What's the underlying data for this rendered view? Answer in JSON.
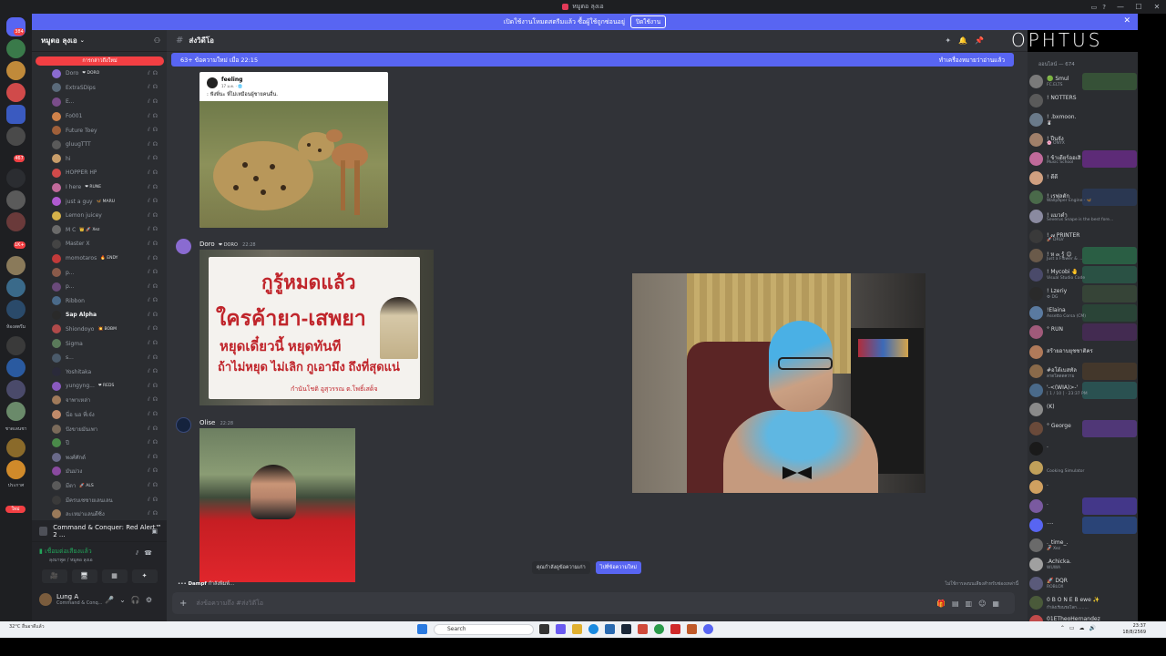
{
  "window": {
    "title": "หมูตอ ลุงเอ",
    "controls": [
      "—",
      "☐",
      "✕"
    ]
  },
  "banner": {
    "text": "เปิดใช้งานโหมดสตรีมแล้ว ซื้อผู้ใช้ถูกซ่อนอยู่",
    "button": "ปิดใช้งาน",
    "close": "✕"
  },
  "rail": {
    "badges": [
      "384",
      "467",
      "1K+"
    ],
    "labels": [
      "ห้องสตรีม",
      "ชาดเลนชา",
      "ประกาศ",
      "ใหม่"
    ]
  },
  "server": {
    "name": "หมูตอ ลุงเอ",
    "chevron": "⌄",
    "new_pill": "การกล่าวถึงใหม่"
  },
  "members_voice": [
    {
      "name": "Doro",
      "tag": "❤ DORO",
      "bold": false,
      "color": "#8a6bd1"
    },
    {
      "name": "ExtraSDips",
      "tag": "",
      "bold": false,
      "color": "#5a6a7a"
    },
    {
      "name": "E...",
      "tag": "",
      "bold": false,
      "color": "#7a4d8a"
    },
    {
      "name": "Fo001",
      "tag": "",
      "bold": false,
      "color": "#d0824a"
    },
    {
      "name": "Future Toey",
      "tag": "",
      "bold": false,
      "color": "#a0603a"
    },
    {
      "name": "gluugTTT",
      "tag": "",
      "bold": false,
      "color": "#5a5a5a"
    },
    {
      "name": "hi",
      "tag": "",
      "bold": false,
      "color": "#c89d6a"
    },
    {
      "name": "HOPPER HP",
      "tag": "",
      "bold": false,
      "color": "#d04a4a"
    },
    {
      "name": "I here",
      "tag": "❤ RUNE",
      "bold": false,
      "color": "#c06a9a"
    },
    {
      "name": "just a guy",
      "tag": "🦋 MARU",
      "bold": false,
      "color": "#b05ad0"
    },
    {
      "name": "Lemon juicey",
      "tag": "",
      "bold": false,
      "color": "#d6b24a"
    },
    {
      "name": "M C",
      "tag": "👑 🚀 Xez",
      "bold": false,
      "color": "#6a6a6a"
    },
    {
      "name": "Master X",
      "tag": "",
      "bold": false,
      "color": "#444"
    },
    {
      "name": "momotaros",
      "tag": "🔥 ENDY",
      "bold": false,
      "color": "#c23a3a"
    },
    {
      "name": "p...",
      "tag": "",
      "bold": false,
      "color": "#8a5a4a"
    },
    {
      "name": "p...",
      "tag": "",
      "bold": false,
      "color": "#6a4a7a"
    },
    {
      "name": "Ribbon",
      "tag": "",
      "bold": false,
      "color": "#4a6a8a"
    },
    {
      "name": "Sap Alpha",
      "tag": "",
      "bold": true,
      "color": "#2a2a2a"
    },
    {
      "name": "Shiondoyo",
      "tag": "💥 BOBM",
      "bold": false,
      "color": "#b04a4a"
    },
    {
      "name": "Sigma",
      "tag": "",
      "bold": false,
      "color": "#5a7a5a"
    },
    {
      "name": "s...",
      "tag": "",
      "bold": false,
      "color": "#4a5a6a"
    },
    {
      "name": "Yoshitaka",
      "tag": "",
      "bold": false,
      "color": "#2a2a3a"
    },
    {
      "name": "yungyng...",
      "tag": "❤ REDS",
      "bold": false,
      "color": "#8a5ac0"
    },
    {
      "name": "จาพาเหล่า",
      "tag": "",
      "bold": false,
      "color": "#a07a5a"
    },
    {
      "name": "นี่อ นอ ที่เจ๋ง",
      "tag": "",
      "bold": false,
      "color": "#c08a6a"
    },
    {
      "name": "ปังขายมันเพา",
      "tag": "",
      "bold": false,
      "color": "#7a6a5a"
    },
    {
      "name": "ปี",
      "tag": "",
      "bold": false,
      "color": "#4a8a4a"
    },
    {
      "name": "พงศ์ศักด์",
      "tag": "",
      "bold": false,
      "color": "#6a6a8a"
    },
    {
      "name": "มันม่วง",
      "tag": "",
      "bold": false,
      "color": "#8a4aa0"
    },
    {
      "name": "มีตา",
      "tag": "🚀 ALS",
      "bold": false,
      "color": "#5a5a5a"
    },
    {
      "name": "มีครบเซซายเลนเลน",
      "tag": "",
      "bold": false,
      "color": "#3a3a3a"
    },
    {
      "name": "ละเหม่าแลนดีซิ่ง",
      "tag": "",
      "bold": false,
      "color": "#9a7a5a"
    }
  ],
  "voice": {
    "activity": "Command & Conquer: Red Alert™ 2 ...",
    "connected": "เชื่อมต่อเสียงแล้ว",
    "channel": "ลุงมาพูด / หมูตอ ลุงเอ",
    "buttons": [
      "🎥",
      "🖥",
      "▦",
      "✦"
    ]
  },
  "user": {
    "name": "Lung A",
    "status": "Command & Conq..."
  },
  "channel": {
    "name": "ส่งวิดีโอ",
    "hash": "#"
  },
  "new_messages": {
    "left": "63+ ข้อความใหม่ เมื่อ 22:15",
    "right": "ทำเครื่องหมายว่าอ่านแล้ว"
  },
  "messages": [
    {
      "author": "Doro",
      "role": "DORO",
      "time": "22:28"
    },
    {
      "author": "Olise",
      "role": "",
      "time": "22:28"
    }
  ],
  "embed": {
    "page": "feeling",
    "sub": "17 ม.ค. · 🌐",
    "caption": ": ฟังพี่นะ พี่ไม่เหมือนผู้ชายคนอื่น."
  },
  "sign": {
    "line1": "กูรู้หมดแล้ว",
    "line2": "ใครค้ายา-เสพยา",
    "line3": "หยุดเดี๋ยวนี้ หยุดทันที",
    "line4": "ถ้าไม่หยุด ไม่เลิก กูเอามึง ถึงที่สุดแน่",
    "line5": "กำนันโชติ อูสุวรรณ ต.โพธิ์เสด็จ"
  },
  "typing": {
    "who": "Dampf",
    "text": "กำลังพิมพ์..."
  },
  "slow_mode": "ไม่ใช้การลงบนเสียงสำหรับช่องเหล่านี้",
  "new_controls": {
    "jump_old": "คุณกำลังดูข้อความเก่า",
    "jump_new": "ไปที่ข้อความใหม่"
  },
  "composer": {
    "placeholder": "ส่งข้อความถึง #ส่งวิดีโอ"
  },
  "brand_overlay": "OPHTUS",
  "member_list": {
    "group_header": "ออนไลน์ — 674",
    "items": [
      {
        "name": "🟢 Smul",
        "sub": "FC.ELTS",
        "color": "#7a7a7a",
        "bg": "#3a5a3a"
      },
      {
        "name": "! NOTTERS",
        "sub": "",
        "color": "#5a5a5a",
        "bg": ""
      },
      {
        "name": "! .bxmoon.",
        "sub": "🐰",
        "color": "#6a7a8a",
        "bg": ""
      },
      {
        "name": "! ปีนจัง",
        "sub": "🌸 ONYX",
        "color": "#a0806a",
        "bg": ""
      },
      {
        "name": "! ข้าเดียร์ออเสิ",
        "sub": "Music School",
        "color": "#c06a9a",
        "bg": "#6a2a8a"
      },
      {
        "name": "! ดีดี",
        "sub": "",
        "color": "#d0a080",
        "bg": ""
      },
      {
        "name": "! เรฟุลตัก",
        "sub": "Wallpaper Engine · 🦋",
        "color": "#4a6a4a",
        "bg": "#2a3a5a"
      },
      {
        "name": "! แมวดำ",
        "sub": "Severus Snape is the best fore...",
        "color": "#8a8aa0",
        "bg": ""
      },
      {
        "name": "! ๗ PRINTER",
        "sub": "🚀 DRLV",
        "color": "#3a3a3a",
        "bg": ""
      },
      {
        "name": "! ห ๓ รู้ 😊",
        "sub": "Just a Flower & ...",
        "color": "#6a5a4a",
        "bg": "#2a6a4a"
      },
      {
        "name": "! Mycobi 🤚",
        "sub": "Visual Studio Code",
        "color": "#4a4a6a",
        "bg": "#2a5a4a"
      },
      {
        "name": "! Lzeriy",
        "sub": "⚙ DG",
        "color": "#2a2a2a",
        "bg": "#3a4a3a"
      },
      {
        "name": "!Elaina",
        "sub": "Assetto Corsa (CM)",
        "color": "#5a7aa0",
        "bg": "#2a4a3a"
      },
      {
        "name": "° RUN",
        "sub": "",
        "color": "#a05a7a",
        "bg": "#4a2a5a"
      },
      {
        "name": "สร้ายอาบยุชชาติคร",
        "sub": "",
        "color": "#b07a5a",
        "bg": ""
      },
      {
        "name": "#อโด้เบสทัล",
        "sub": "ลาดโดดดความ",
        "color": "#8a6a4a",
        "bg": "#4a3a2a"
      },
      {
        "name": "'-<(WIA)>-'",
        "sub": "[ 1 / 10 ] · 23:37 PM",
        "color": "#4a6a8a",
        "bg": "#2a5a5a"
      },
      {
        "name": "(K)",
        "sub": "",
        "color": "#8a8a8a",
        "bg": ""
      },
      {
        "name": "° George",
        "sub": "",
        "color": "#6a4a3a",
        "bg": "#5a3a8a"
      },
      {
        "name": ".",
        "sub": "",
        "color": "#1a1a1a",
        "bg": ""
      },
      {
        "name": "",
        "sub": "Cooking Simulator",
        "color": "#c0a05a",
        "bg": ""
      },
      {
        "name": ".",
        "sub": "",
        "color": "#d0a060",
        "bg": ""
      },
      {
        "name": ".",
        "sub": "",
        "color": "#7a5aa0",
        "bg": "#4a3aa0"
      },
      {
        "name": "....",
        "sub": "",
        "color": "#5865f2",
        "bg": "#2a4a8a"
      },
      {
        "name": "._time_.",
        "sub": "🚀 Xez",
        "color": "#6a6a6a",
        "bg": ""
      },
      {
        "name": ".Achicka.",
        "sub": "WUWA",
        "color": "#a0a0a0",
        "bg": ""
      },
      {
        "name": "🚀 DQR",
        "sub": "ROBLOX",
        "color": "#5a5a7a",
        "bg": ""
      },
      {
        "name": "0 B O N E B ewe ✨",
        "sub": "กำลังเรียนรอโลก.........",
        "color": "#4a5a3a",
        "bg": ""
      },
      {
        "name": "01ETheoHernandez",
        "sub": "",
        "color": "#c04a4a",
        "bg": ""
      }
    ]
  },
  "taskbar": {
    "weather": "32°C อื่นอาดีแล้ว",
    "search": "Search",
    "time": "23:37",
    "date": "18/8/2569"
  }
}
